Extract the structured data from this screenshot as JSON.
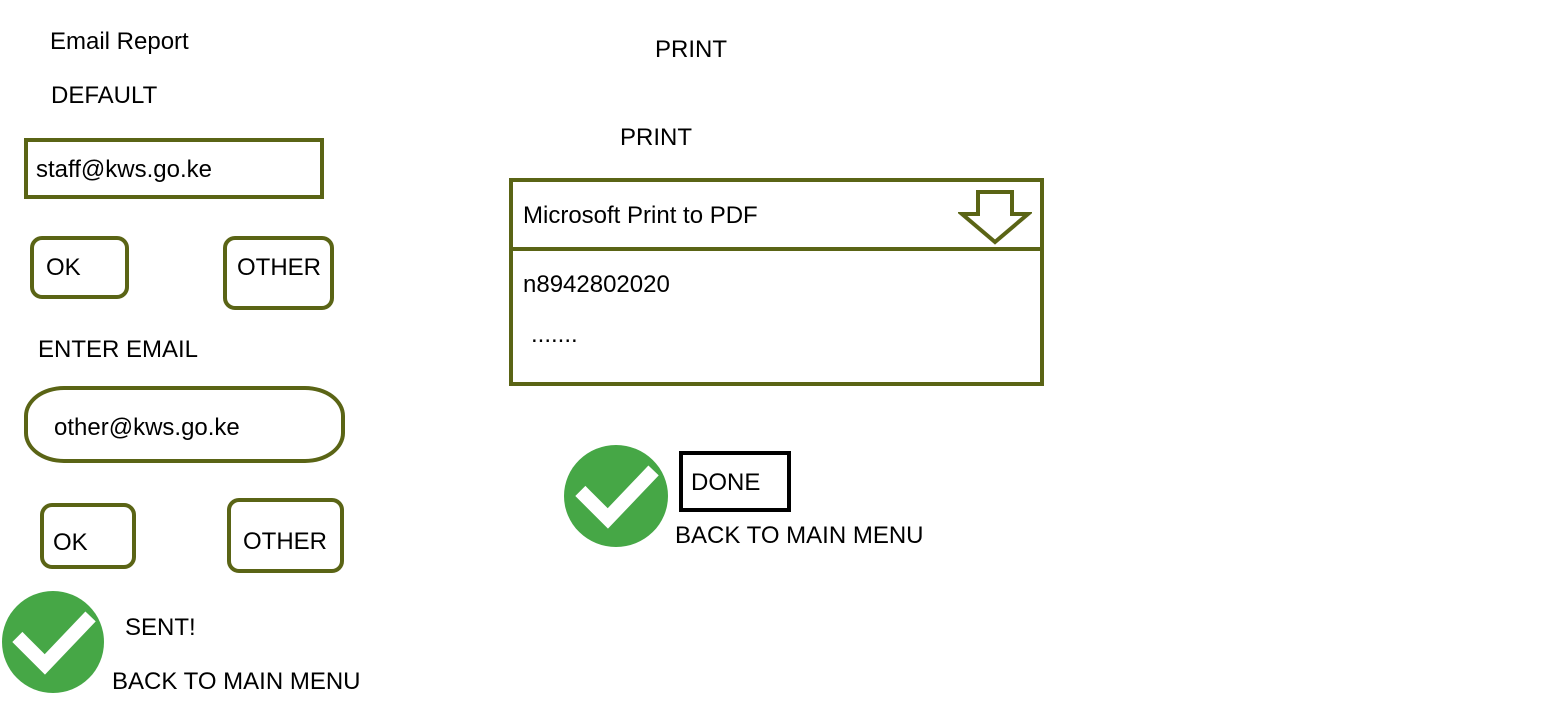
{
  "email": {
    "title": "Email Report",
    "default_label": "DEFAULT",
    "default_email": "staff@kws.go.ke",
    "ok_label": "OK",
    "other_label": "OTHER",
    "enter_email_label": "ENTER EMAIL",
    "other_email": "other@kws.go.ke",
    "ok_label_2": "OK",
    "other_label_2": "OTHER",
    "sent_label": "SENT!",
    "back_label": "BACK TO MAIN MENU"
  },
  "print": {
    "title": "PRINT",
    "section_label": "PRINT",
    "printer_selected": "Microsoft Print to PDF",
    "printer_options": [
      "n8942802020",
      "......."
    ],
    "done_label": "DONE",
    "back_label": "BACK TO MAIN MENU"
  },
  "colors": {
    "border_olive": "#5a6415",
    "check_green": "#46a746"
  },
  "icons": [
    "check-icon",
    "down-arrow-icon"
  ]
}
